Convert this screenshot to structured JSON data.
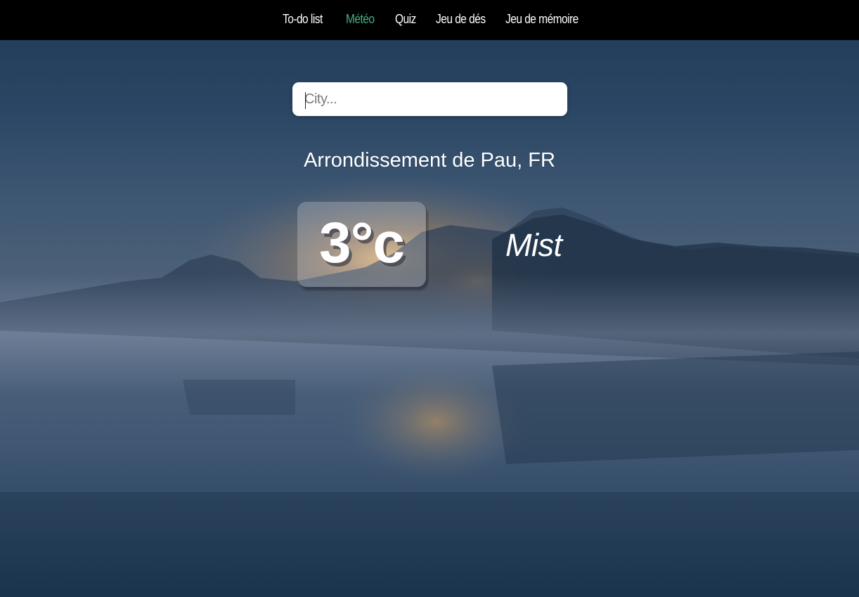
{
  "nav": {
    "items": [
      {
        "label": "To-do list",
        "active": false
      },
      {
        "label": "Météo",
        "active": true
      },
      {
        "label": "Quiz",
        "active": false
      },
      {
        "label": "Jeu de dés",
        "active": false
      },
      {
        "label": "Jeu de mémoire",
        "active": false
      }
    ],
    "active_color": "#45b07e",
    "background": "#000000"
  },
  "search": {
    "placeholder": "City...",
    "value": ""
  },
  "weather": {
    "location": "Arrondissement de Pau, FR",
    "temperature": "3°c",
    "condition": "Mist"
  },
  "background_scene": "misty-lake-sunrise"
}
